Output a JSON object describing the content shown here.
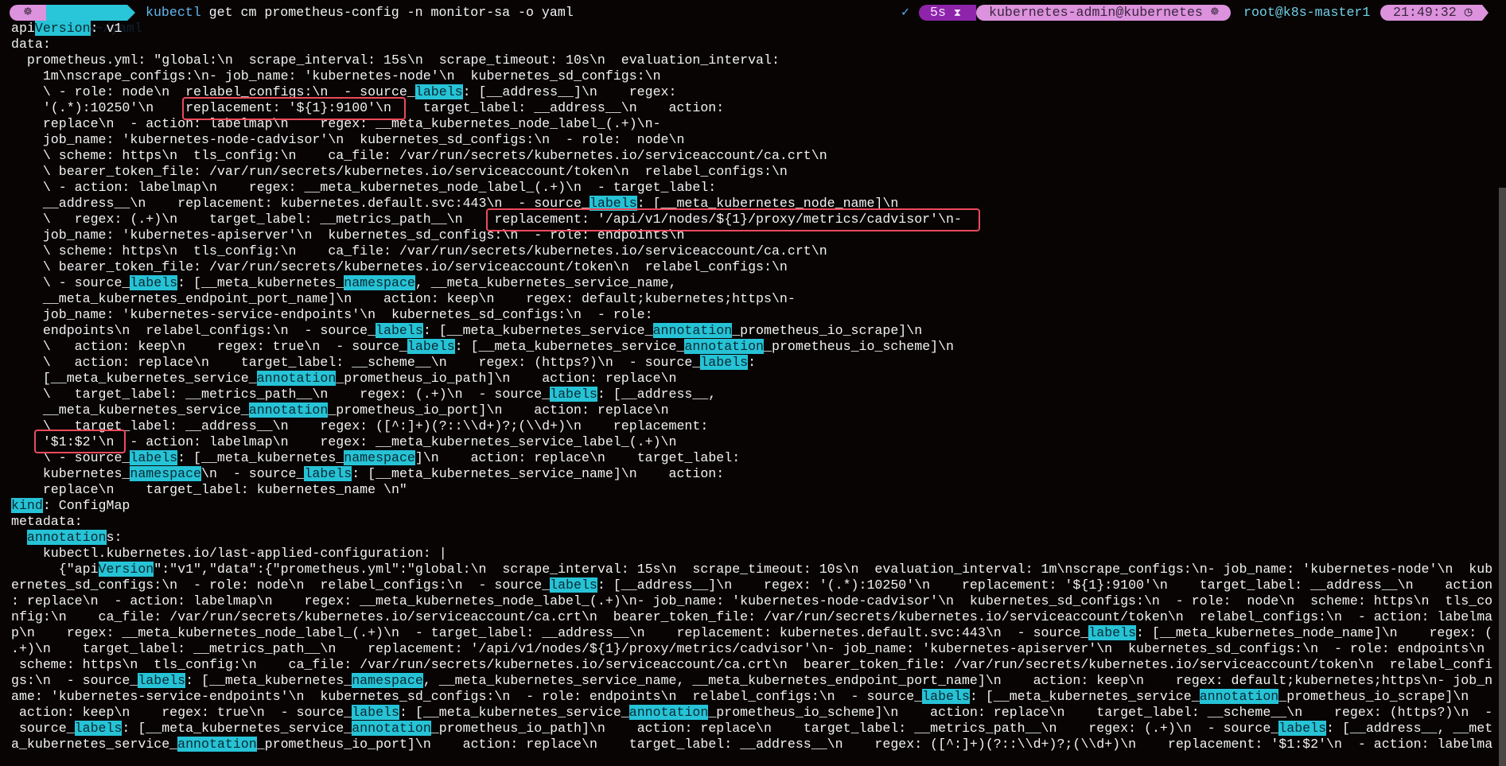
{
  "prompt": {
    "dir": "~/yaml",
    "command_name": "kubectl",
    "command_args": " get cm prometheus-config -n monitor-sa -o yaml",
    "status_check": "✓",
    "duration": "5s",
    "hourglass": "⌛",
    "context": "kubernetes-admin@kubernetes",
    "k8s_glyph": "☸",
    "user_host": "root@k8s-master1",
    "time": "21:49:32",
    "clock_glyph": "🕘",
    "folder_glyph": "📂"
  },
  "highlight_terms": [
    "Version",
    "labels",
    "namespace",
    "annotation",
    "kind"
  ],
  "colors": {
    "highlight": "#26c3d6",
    "box": "#ec4a5a",
    "prompt_pink": "#dc92dc",
    "prompt_cyan": "#29c5d8",
    "prompt_purple": "#8e24aa"
  },
  "output": {
    "lines": [
      "apiVersion: v1",
      "data:",
      "  prometheus.yml: \"global:\\n  scrape_interval: 15s\\n  scrape_timeout: 10s\\n  evaluation_interval:",
      "    1m\\nscrape_configs:\\n- job_name: 'kubernetes-node'\\n  kubernetes_sd_configs:\\n",
      "    \\ - role: node\\n  relabel_configs:\\n  - source_labels: [__address__]\\n    regex:",
      "    '(.*):10250'\\n    replacement: '${1}:9100'\\n    target_label: __address__\\n    action:",
      "    replace\\n  - action: labelmap\\n    regex: __meta_kubernetes_node_label_(.+)\\n-",
      "    job_name: 'kubernetes-node-cadvisor'\\n  kubernetes_sd_configs:\\n  - role:  node\\n",
      "    \\ scheme: https\\n  tls_config:\\n    ca_file: /var/run/secrets/kubernetes.io/serviceaccount/ca.crt\\n",
      "    \\ bearer_token_file: /var/run/secrets/kubernetes.io/serviceaccount/token\\n  relabel_configs:\\n",
      "    \\ - action: labelmap\\n    regex: __meta_kubernetes_node_label_(.+)\\n  - target_label:",
      "    __address__\\n    replacement: kubernetes.default.svc:443\\n  - source_labels: [__meta_kubernetes_node_name]\\n",
      "    \\   regex: (.+)\\n    target_label: __metrics_path__\\n    replacement: '/api/v1/nodes/${1}/proxy/metrics/cadvisor'\\n-",
      "    job_name: 'kubernetes-apiserver'\\n  kubernetes_sd_configs:\\n  - role: endpoints\\n",
      "    \\ scheme: https\\n  tls_config:\\n    ca_file: /var/run/secrets/kubernetes.io/serviceaccount/ca.crt\\n",
      "    \\ bearer_token_file: /var/run/secrets/kubernetes.io/serviceaccount/token\\n  relabel_configs:\\n",
      "    \\ - source_labels: [__meta_kubernetes_namespace, __meta_kubernetes_service_name,",
      "    __meta_kubernetes_endpoint_port_name]\\n    action: keep\\n    regex: default;kubernetes;https\\n-",
      "    job_name: 'kubernetes-service-endpoints'\\n  kubernetes_sd_configs:\\n  - role:",
      "    endpoints\\n  relabel_configs:\\n  - source_labels: [__meta_kubernetes_service_annotation_prometheus_io_scrape]\\n",
      "    \\   action: keep\\n    regex: true\\n  - source_labels: [__meta_kubernetes_service_annotation_prometheus_io_scheme]\\n",
      "    \\   action: replace\\n    target_label: __scheme__\\n    regex: (https?)\\n  - source_labels:",
      "    [__meta_kubernetes_service_annotation_prometheus_io_path]\\n    action: replace\\n",
      "    \\   target_label: __metrics_path__\\n    regex: (.+)\\n  - source_labels: [__address__,",
      "    __meta_kubernetes_service_annotation_prometheus_io_port]\\n    action: replace\\n",
      "    \\   target_label: __address__\\n    regex: ([^:]+)(?::\\\\d+)?;(\\\\d+)\\n    replacement:",
      "    '$1:$2'\\n  - action: labelmap\\n    regex: __meta_kubernetes_service_label_(.+)\\n",
      "    \\ - source_labels: [__meta_kubernetes_namespace]\\n    action: replace\\n    target_label:",
      "    kubernetes_namespace\\n  - source_labels: [__meta_kubernetes_service_name]\\n    action:",
      "    replace\\n    target_label: kubernetes_name \\n\"",
      "kind: ConfigMap",
      "metadata:",
      "  annotations:",
      "    kubectl.kubernetes.io/last-applied-configuration: |",
      "      {\"apiVersion\":\"v1\",\"data\":{\"prometheus.yml\":\"global:\\n  scrape_interval: 15s\\n  scrape_timeout: 10s\\n  evaluation_interval: 1m\\nscrape_configs:\\n- job_name: 'kubernetes-node'\\n  kub",
      "ernetes_sd_configs:\\n  - role: node\\n  relabel_configs:\\n  - source_labels: [__address__]\\n    regex: '(.*):10250'\\n    replacement: '${1}:9100'\\n    target_label: __address__\\n    action",
      ": replace\\n  - action: labelmap\\n    regex: __meta_kubernetes_node_label_(.+)\\n- job_name: 'kubernetes-node-cadvisor'\\n  kubernetes_sd_configs:\\n  - role:  node\\n  scheme: https\\n  tls_co",
      "nfig:\\n    ca_file: /var/run/secrets/kubernetes.io/serviceaccount/ca.crt\\n  bearer_token_file: /var/run/secrets/kubernetes.io/serviceaccount/token\\n  relabel_configs:\\n  - action: labelma",
      "p\\n    regex: __meta_kubernetes_node_label_(.+)\\n  - target_label: __address__\\n    replacement: kubernetes.default.svc:443\\n  - source_labels: [__meta_kubernetes_node_name]\\n    regex: (",
      ".+)\\n    target_label: __metrics_path__\\n    replacement: '/api/v1/nodes/${1}/proxy/metrics/cadvisor'\\n- job_name: 'kubernetes-apiserver'\\n  kubernetes_sd_configs:\\n  - role: endpoints\\n ",
      " scheme: https\\n  tls_config:\\n    ca_file: /var/run/secrets/kubernetes.io/serviceaccount/ca.crt\\n  bearer_token_file: /var/run/secrets/kubernetes.io/serviceaccount/token\\n  relabel_confi",
      "gs:\\n  - source_labels: [__meta_kubernetes_namespace, __meta_kubernetes_service_name, __meta_kubernetes_endpoint_port_name]\\n    action: keep\\n    regex: default;kubernetes;https\\n- job_n",
      "ame: 'kubernetes-service-endpoints'\\n  kubernetes_sd_configs:\\n  - role: endpoints\\n  relabel_configs:\\n  - source_labels: [__meta_kubernetes_service_annotation_prometheus_io_scrape]\\n ",
      " action: keep\\n    regex: true\\n  - source_labels: [__meta_kubernetes_service_annotation_prometheus_io_scheme]\\n    action: replace\\n    target_label: __scheme__\\n    regex: (https?)\\n  -",
      " source_labels: [__meta_kubernetes_service_annotation_prometheus_io_path]\\n    action: replace\\n    target_label: __metrics_path__\\n    regex: (.+)\\n  - source_labels: [__address__, __met",
      "a_kubernetes_service_annotation_prometheus_io_port]\\n    action: replace\\n    target_label: __address__\\n    regex: ([^:]+)(?::\\\\d+)?;(\\\\d+)\\n    replacement: '$1:$2'\\n  - action: labelma"
    ]
  }
}
